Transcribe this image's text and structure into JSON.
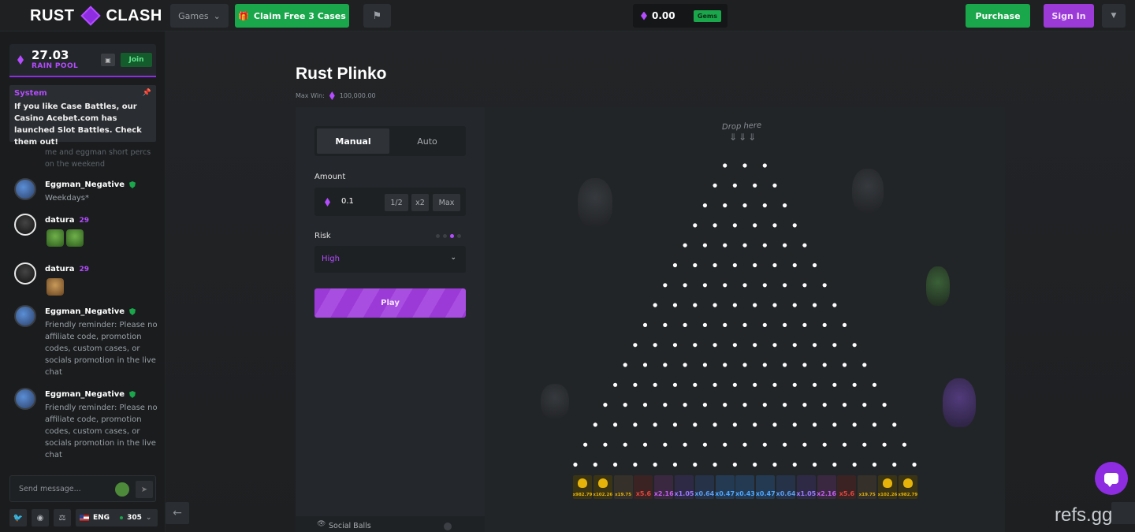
{
  "brand": {
    "left": "RUST",
    "right": "CLASH"
  },
  "topbar": {
    "games_label": "Games",
    "claim_label": "Claim Free 3 Cases",
    "balance": "0.00",
    "balance_currency": "Gems",
    "purchase_label": "Purchase",
    "signin_label": "Sign In"
  },
  "rain_pool": {
    "amount": "27.03",
    "label": "RAIN POOL",
    "join_label": "Join"
  },
  "system_message": {
    "title": "System",
    "text": "If you like Case Battles, our Casino Acebet.com has launched Slot Battles. Check them out!"
  },
  "chat": {
    "faded_text": "me and eggman short percs on the weekend",
    "messages": [
      {
        "user": "Eggman_Negative",
        "badge": "",
        "text": "Weekdays*"
      },
      {
        "user": "datura",
        "badge": "29",
        "text": ""
      },
      {
        "user": "datura",
        "badge": "29",
        "text": ""
      },
      {
        "user": "Eggman_Negative",
        "badge": "",
        "text": "Friendly reminder: Please no affiliate code, promotion codes, custom cases, or socials promotion in the live chat"
      },
      {
        "user": "Eggman_Negative",
        "badge": "",
        "text": "Friendly reminder: Please no affiliate code, promotion codes, custom cases, or socials promotion in the live chat"
      }
    ],
    "input_placeholder": "Send message...",
    "language": "ENG",
    "online_count": "305"
  },
  "game": {
    "title": "Rust Plinko",
    "max_win_label": "Max Win:",
    "max_win_value": "100,000.00",
    "tabs": [
      "Manual",
      "Auto"
    ],
    "amount_label": "Amount",
    "amount_value": "0.1",
    "amount_buttons": [
      "1/2",
      "x2",
      "Max"
    ],
    "risk_label": "Risk",
    "risk_value": "High",
    "play_label": "Play",
    "social_label": "Social Balls",
    "drop_here": "Drop here"
  },
  "plinko": {
    "rows": 16,
    "multipliers": [
      "x982.79",
      "x102.26",
      "x19.75",
      "x5.6",
      "x2.16",
      "x1.05",
      "x0.64",
      "x0.47",
      "x0.43",
      "x0.47",
      "x0.64",
      "x1.05",
      "x2.16",
      "x5.6",
      "x19.75",
      "x102.26",
      "x982.79"
    ],
    "bucket_colors": [
      "#3a3414",
      "#3a3414",
      "#35302a",
      "#3b2324",
      "#3a2740",
      "#2e2a45",
      "#253247",
      "#233a52",
      "#233a52",
      "#233a52",
      "#253247",
      "#2e2a45",
      "#3a2740",
      "#3b2324",
      "#35302a",
      "#3a3414",
      "#3a3414"
    ],
    "text_colors": [
      "#e5b30a",
      "#e5b30a",
      "#e5b30a",
      "#e0463b",
      "#c45cf0",
      "#9a78ff",
      "#5a9cf0",
      "#4da6ff",
      "#4da6ff",
      "#4da6ff",
      "#5a9cf0",
      "#9a78ff",
      "#c45cf0",
      "#e0463b",
      "#e5b30a",
      "#e5b30a",
      "#e5b30a"
    ]
  },
  "watermark": "refs.gg",
  "colors": {
    "accent": "#8d2ce0",
    "green": "#1aa64a",
    "bg": "#1b1d1f"
  }
}
